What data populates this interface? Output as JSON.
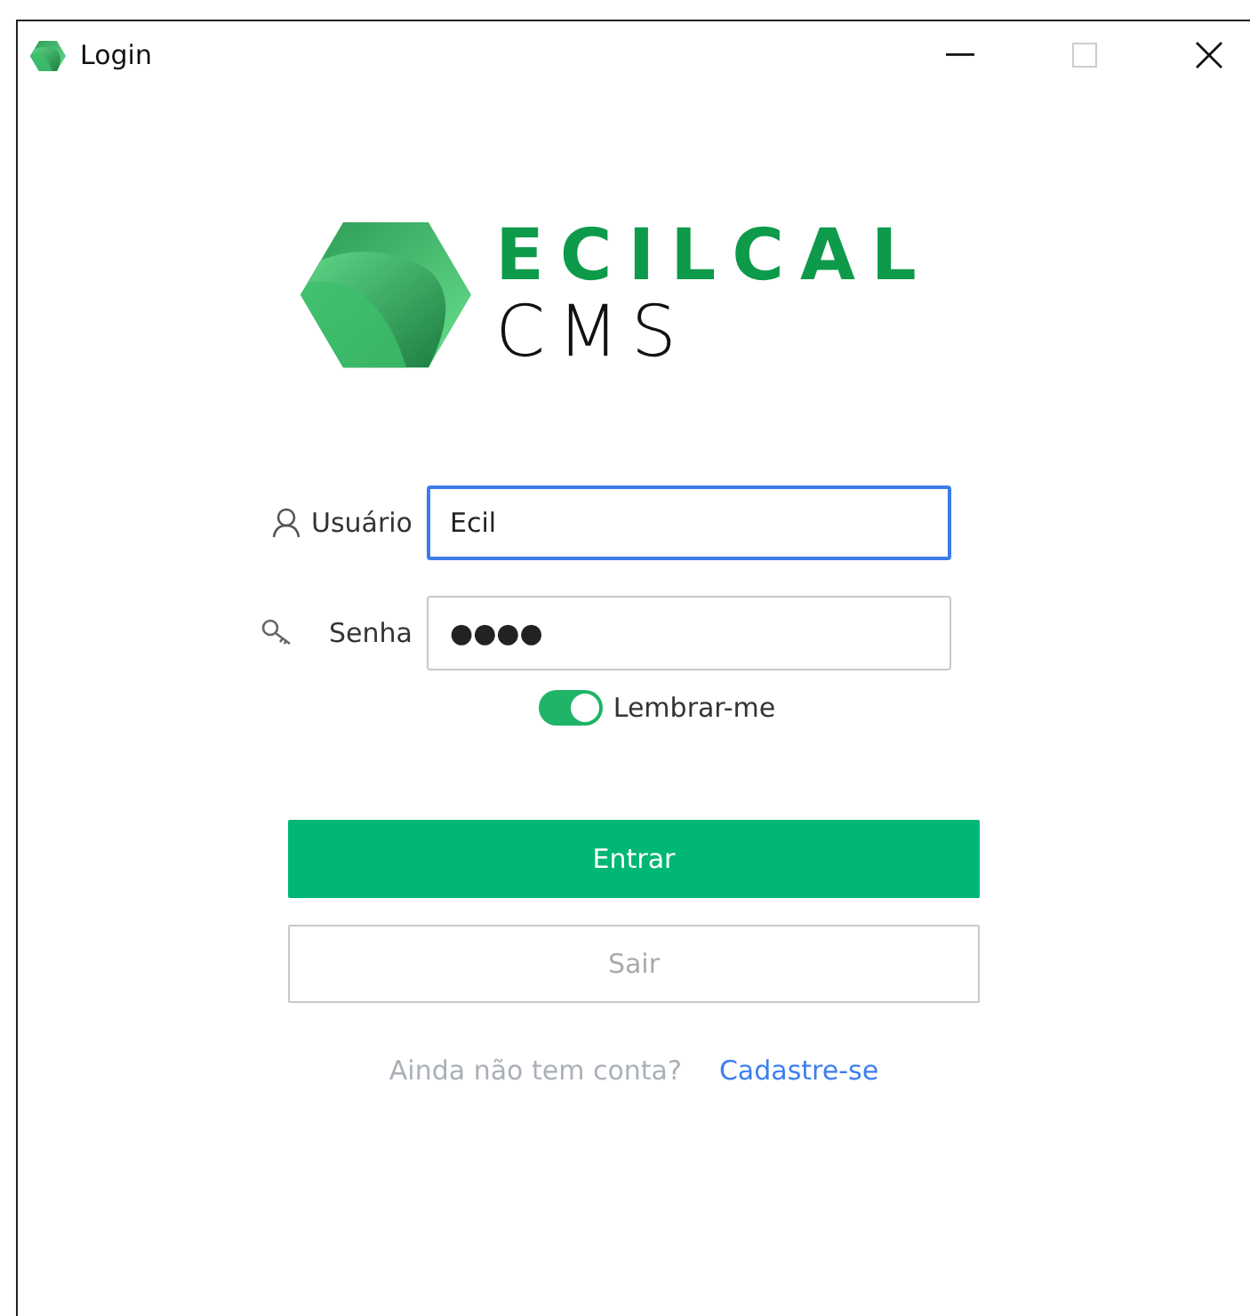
{
  "window": {
    "title": "Login"
  },
  "logo": {
    "brand": "ECILCAL",
    "product": "CMS"
  },
  "fields": [
    {
      "kind": "user",
      "label": "Usuário",
      "value": "Ecil",
      "focused": true
    },
    {
      "kind": "password",
      "label": "Senha",
      "value": "●●●●",
      "focused": false
    }
  ],
  "remember": {
    "label": "Lembrar-me",
    "on": true
  },
  "buttons": [
    {
      "kind": "primary",
      "label": "Entrar"
    },
    {
      "kind": "secondary",
      "label": "Sair"
    }
  ],
  "signup": {
    "prompt": "Ainda não tem conta?",
    "link": "Cadastre-se"
  }
}
